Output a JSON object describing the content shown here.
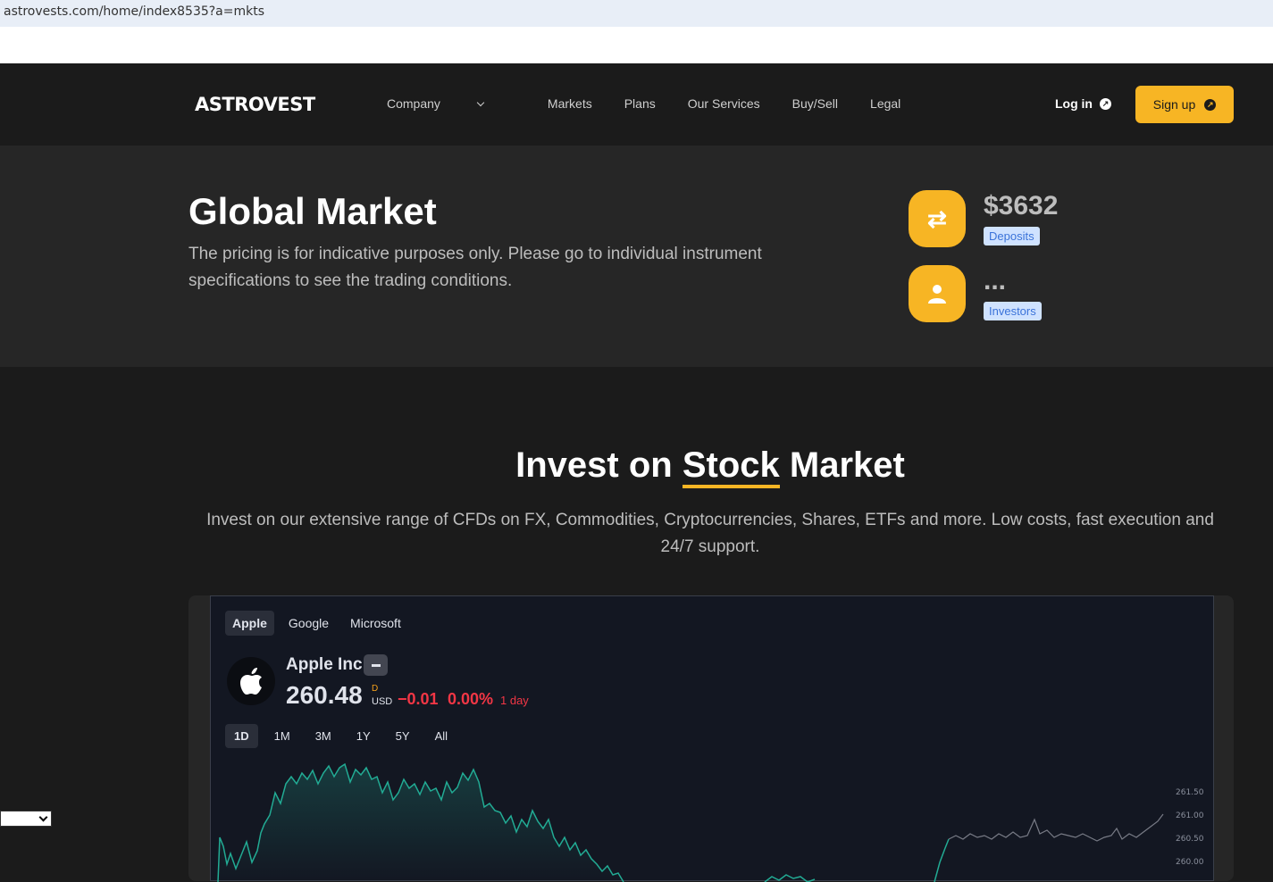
{
  "browser": {
    "url": "astrovests.com/home/index8535?a=mkts"
  },
  "nav": {
    "logo": "ASTROVEST",
    "menu": [
      "Company",
      "Markets",
      "Plans",
      "Our Services",
      "Buy/Sell",
      "Legal"
    ],
    "login": "Log in",
    "signup": "Sign up"
  },
  "hero": {
    "title": "Global Market",
    "description": "The pricing is for indicative purposes only. Please go to individual instrument specifications to see the trading conditions.",
    "stats": [
      {
        "value": "$3632",
        "label": "Deposits",
        "icon": "exchange-arrows-icon"
      },
      {
        "value": "...",
        "label": "Investors",
        "icon": "user-icon"
      }
    ]
  },
  "section": {
    "title_before": "Invest on",
    "title_highlight": "Stock",
    "title_after": "Market",
    "description": "Invest on our extensive range of CFDs on FX, Commodities, Cryptocurrencies, Shares, ETFs and more. Low costs, fast execution and 24/7 support."
  },
  "widget": {
    "tabs": [
      "Apple",
      "Google",
      "Microsoft"
    ],
    "active_tab": "Apple",
    "symbol_name": "Apple Inc",
    "price": "260.48",
    "currency_flag": "D",
    "currency": "USD",
    "change": "−0.01",
    "change_pct": "0.00%",
    "period": "1 day",
    "ranges": [
      "1D",
      "1M",
      "3M",
      "1Y",
      "5Y",
      "All"
    ],
    "active_range": "1D",
    "colors": {
      "up": "#22ab94",
      "down": "#f23645",
      "accent": "#f7b524"
    }
  },
  "chart_data": {
    "type": "line",
    "y_tick_labels": [
      "261.50",
      "261.00",
      "260.50",
      "260.00"
    ],
    "ylim": [
      260.0,
      261.5
    ]
  }
}
